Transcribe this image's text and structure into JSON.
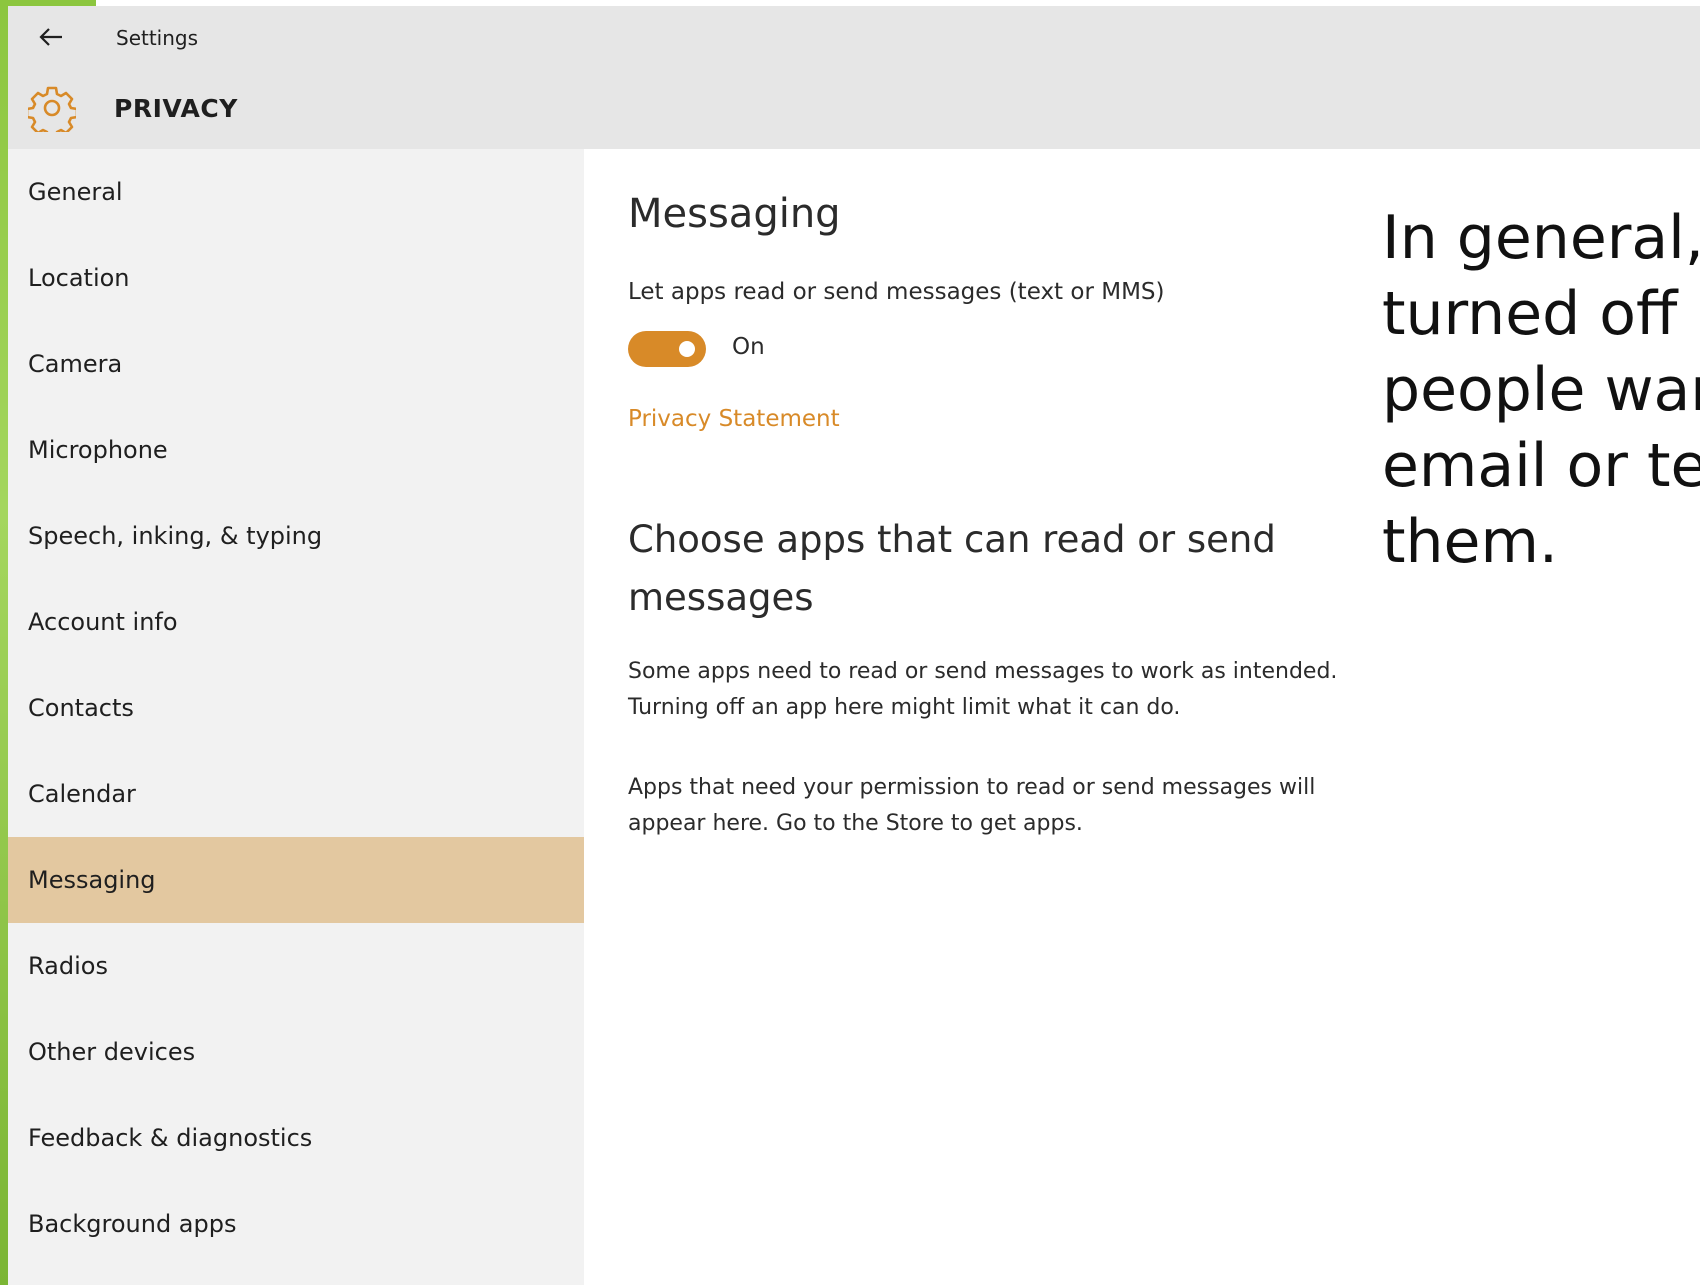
{
  "window": {
    "title": "Settings",
    "section": "PRIVACY"
  },
  "sidebar": {
    "items": [
      {
        "label": "General"
      },
      {
        "label": "Location"
      },
      {
        "label": "Camera"
      },
      {
        "label": "Microphone"
      },
      {
        "label": "Speech, inking, & typing"
      },
      {
        "label": "Account info"
      },
      {
        "label": "Contacts"
      },
      {
        "label": "Calendar"
      },
      {
        "label": "Messaging",
        "selected": true
      },
      {
        "label": "Radios"
      },
      {
        "label": "Other devices"
      },
      {
        "label": "Feedback & diagnostics"
      },
      {
        "label": "Background apps"
      }
    ]
  },
  "main": {
    "heading": "Messaging",
    "setting_label": "Let apps read or send messages (text or MMS)",
    "toggle_state": "On",
    "toggle_on": true,
    "privacy_link": "Privacy Statement",
    "choose_heading": "Choose apps that can read or send messages",
    "para1_line1": "Some apps need to read or send messages to work as intended.",
    "para1_line2": "Turning off an app here might limit what it can do.",
    "para2_line1": "Apps that need your permission to read or send messages will",
    "para2_line2": "appear here. Go to the Store to get apps."
  },
  "overlay": {
    "lines": [
      "In general,",
      "turned off a",
      "people wan",
      "email or te",
      "them."
    ]
  },
  "colors": {
    "accent": "#d88a28",
    "selected_bg": "#e3c8a0",
    "sidebar_bg": "#f2f2f2",
    "titlebar_bg": "#e6e6e6",
    "slide_green": "#8cc63f"
  },
  "icons": {
    "back": "back-arrow-icon",
    "section": "gear-icon"
  }
}
